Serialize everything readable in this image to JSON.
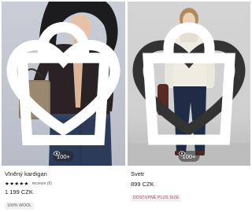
{
  "products": [
    {
      "title": "Vlněný kardigan",
      "rating_stars": "★★★★★",
      "reviews": "recenze (6)",
      "price": "1 199 CZK",
      "badge": "100% WOOL",
      "views": "100+",
      "icons": {
        "favorite": "heart-icon",
        "bag": "shopping-bag-icon",
        "views": "eye-icon"
      }
    },
    {
      "title": "Svetr",
      "price": "899 CZK",
      "badge": "DOSTUPNÉ PLUS SIZE",
      "views": "100+",
      "icons": {
        "favorite": "heart-icon",
        "bag": "shopping-bag-icon",
        "views": "eye-icon"
      }
    }
  ],
  "colors": {
    "badge_plus": "#8b4a63",
    "overlay": "#282828",
    "text": "#1a1a1a"
  }
}
